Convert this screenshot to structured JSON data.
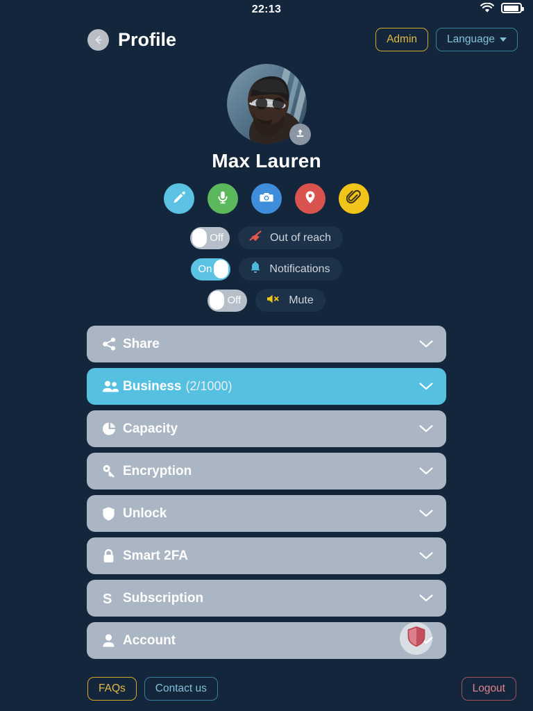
{
  "statusbar": {
    "time": "22:13",
    "wifi_icon": "wifi-icon",
    "battery_icon": "battery-icon"
  },
  "header": {
    "back_icon": "arrow-left-icon",
    "title": "Profile",
    "admin_label": "Admin",
    "language_label": "Language",
    "language_caret_icon": "caret-down-icon"
  },
  "profile": {
    "avatar_alt": "avatar",
    "upload_icon": "upload-icon",
    "name": "Max Lauren"
  },
  "actions": [
    {
      "name": "edit-action",
      "icon": "pencil-icon",
      "color": "#5bc2e3"
    },
    {
      "name": "voice-action",
      "icon": "microphone-icon",
      "color": "#5cb85c"
    },
    {
      "name": "camera-action",
      "icon": "camera-icon",
      "color": "#3f8edc"
    },
    {
      "name": "location-action",
      "icon": "map-pin-icon",
      "color": "#d9534f"
    },
    {
      "name": "attach-action",
      "icon": "paperclip-icon",
      "color": "#f0c419"
    }
  ],
  "toggles": [
    {
      "state_label": "Off",
      "on": false,
      "label": "Out of reach",
      "icon": "signal-off-icon",
      "icon_color": "#e2574c"
    },
    {
      "state_label": "On",
      "on": true,
      "label": "Notifications",
      "icon": "bell-icon",
      "icon_color": "#4fb8dd"
    },
    {
      "state_label": "Off",
      "on": false,
      "label": "Mute",
      "icon": "volume-mute-icon",
      "icon_color": "#f0c419"
    }
  ],
  "list": [
    {
      "label": "Share",
      "sub": "",
      "icon": "share-icon",
      "active": false,
      "chevron_icon": "chevron-down-icon"
    },
    {
      "label": "Business",
      "sub": "(2/1000)",
      "icon": "users-icon",
      "active": true,
      "chevron_icon": "chevron-down-icon"
    },
    {
      "label": "Capacity",
      "sub": "",
      "icon": "pie-chart-icon",
      "active": false,
      "chevron_icon": "chevron-down-icon"
    },
    {
      "label": "Encryption",
      "sub": "",
      "icon": "key-icon",
      "active": false,
      "chevron_icon": "chevron-down-icon"
    },
    {
      "label": "Unlock",
      "sub": "",
      "icon": "shield-icon",
      "active": false,
      "chevron_icon": "chevron-down-icon"
    },
    {
      "label": "Smart 2FA",
      "sub": "",
      "icon": "lock-icon",
      "active": false,
      "chevron_icon": "chevron-down-icon"
    },
    {
      "label": "Subscription",
      "sub": "",
      "icon": "stripe-s-icon",
      "active": false,
      "chevron_icon": "chevron-down-icon"
    },
    {
      "label": "Account",
      "sub": "",
      "icon": "user-icon",
      "active": false,
      "chevron_icon": "chevron-down-icon"
    }
  ],
  "floating_badge": {
    "icon": "shield-half-icon",
    "color": "#cc5566"
  },
  "bottombar": {
    "faqs_label": "FAQs",
    "contact_label": "Contact us",
    "logout_label": "Logout"
  },
  "colors": {
    "background": "#13263c",
    "row": "#aab6c3",
    "row_active": "#56c0e0",
    "accent_gold": "#e3bb44",
    "accent_teal": "#83c2da",
    "accent_red": "#e0818f"
  }
}
